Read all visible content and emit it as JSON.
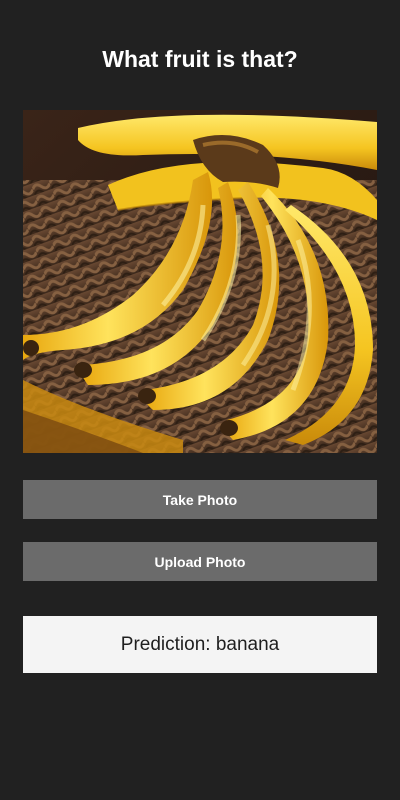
{
  "app": {
    "title": "What fruit is that?"
  },
  "image": {
    "subject": "bunch of bananas on a woven basket"
  },
  "buttons": {
    "take_photo": "Take Photo",
    "upload_photo": "Upload Photo"
  },
  "prediction": {
    "label": "Prediction:",
    "value": "banana"
  },
  "colors": {
    "background": "#212121",
    "button": "#6b6b6b",
    "button_text": "#ffffff",
    "prediction_bg": "#f4f4f4",
    "prediction_text": "#1f1f1f"
  }
}
